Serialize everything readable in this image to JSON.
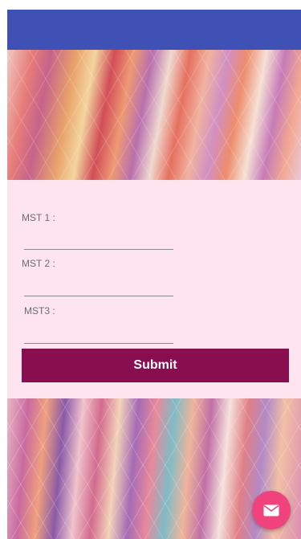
{
  "app_bar": {
    "color": "#3f51b5"
  },
  "form": {
    "background": "#fde4ef",
    "fields": [
      {
        "label": "MST 1 :",
        "value": "",
        "placeholder": ""
      },
      {
        "label": "MST 2 :",
        "value": "",
        "placeholder": ""
      },
      {
        "label": "MST3  :",
        "value": "",
        "placeholder": ""
      }
    ],
    "submit_label": "Submit",
    "submit_color": "#880e4f"
  },
  "fab": {
    "icon": "email-icon",
    "color": "#f0437e"
  }
}
